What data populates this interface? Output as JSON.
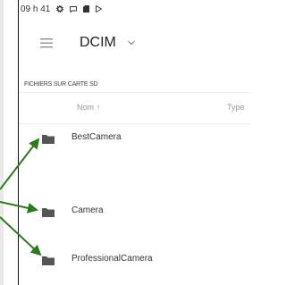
{
  "status_bar": {
    "time": "09 h 41",
    "icons": [
      "gear-icon",
      "message-icon",
      "sd-card-icon",
      "play-icon"
    ]
  },
  "app_bar": {
    "menu_icon": "hamburger-menu-icon",
    "title": "DCIM",
    "dropdown_icon": "chevron-down-icon"
  },
  "section_label": "FICHIERS SUR CARTE SD",
  "list_header": {
    "name_label": "Nom",
    "sort_arrow": "↑",
    "type_label": "Type"
  },
  "files": [
    {
      "name": "BestCamera",
      "icon": "folder-icon"
    },
    {
      "name": "Camera",
      "icon": "folder-icon"
    },
    {
      "name": "ProfessionalCamera",
      "icon": "folder-icon"
    }
  ],
  "colors": {
    "annotation_arrow": "#2d7a1c",
    "folder": "#555555"
  }
}
